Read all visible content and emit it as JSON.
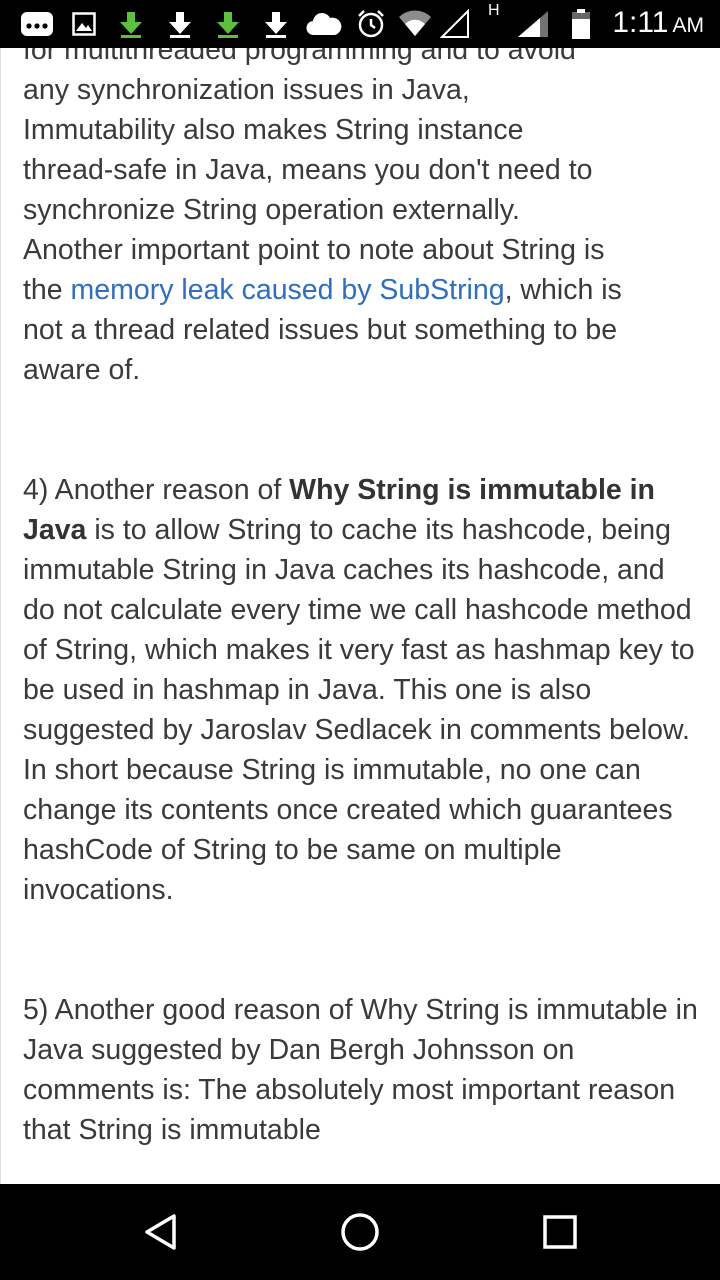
{
  "status_bar": {
    "time": "1:11",
    "ampm": "AM",
    "network_type": "H",
    "icons": [
      "more-icon",
      "image-icon",
      "download-icon",
      "download-icon",
      "download-icon",
      "download-icon",
      "cloud-icon",
      "alarm-icon",
      "wifi-icon",
      "signal-icon",
      "signal-icon",
      "battery-icon"
    ]
  },
  "article": {
    "p1_cut": "for multithreaded programming and to avoid",
    "p1_line2": "any synchronization issues in Java,",
    "p1_line3": "Immutability also makes String instance",
    "p1_line4": "thread-safe in Java, means you don't need to",
    "p1_line5": "synchronize String operation externally.",
    "p1_line6": "Another important point to note about String is",
    "p1_the": "the ",
    "p1_link": "memory leak caused by SubString",
    "p1_after_link": ", which is",
    "p1_line8": "not a thread related issues but something to be",
    "p1_line9": "aware of.",
    "p2_prefix": "4) Another reason of ",
    "p2_bold": "Why String is immutable in Java",
    "p2_rest": " is to allow String to cache its hashcode, being immutable String in Java caches its hashcode, and do not calculate every time we call hashcode method of String, which makes it very fast as hashmap key to be used in hashmap in Java.  This one is also suggested by  Jaroslav Sedlacek in comments below. In short because String is immutable, no one can change its contents once created which guarantees hashCode of String to be same on multiple invocations.",
    "p3_text": "5) Another good reason of Why String is immutable in Java suggested by Dan Bergh Johnsson on comments is: The absolutely most important reason that String is immutable"
  },
  "nav_bar": {
    "back": "back-icon",
    "home": "home-icon",
    "recents": "recents-icon"
  }
}
